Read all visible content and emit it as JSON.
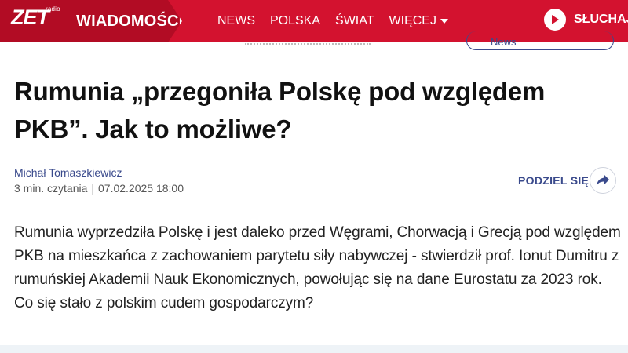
{
  "header": {
    "logo_text": "ZET",
    "logo_sub": "radio",
    "section": "WIADOMOŚCI",
    "nav": [
      "NEWS",
      "POLSKA",
      "ŚWIAT",
      "WIĘCEJ"
    ],
    "listen_label": "SŁUCHAJ R"
  },
  "peek": {
    "pill_text": "News"
  },
  "article": {
    "title": "Rumunia „przegoniła Polskę pod względem PKB”. Jak to możliwe?",
    "author": "Michał Tomaszkiewicz",
    "read_time": "3 min. czytania",
    "date": "07.02.2025 18:00",
    "share_label": "PODZIEL SIĘ",
    "lead": "Rumunia wyprzedziła Polskę i jest daleko przed Węgrami, Chorwacją i Grecją pod względem PKB na mieszkańca z zachowaniem parytetu siły nabywczej - stwierdził prof. Ionut Dumitru z rumuńskiej Akademii Nauk Ekonomicznych, powołując się na dane Eurostatu za 2023 rok. Co się stało z polskim cudem gospodarczym?"
  },
  "colors": {
    "brand_red": "#d3122f",
    "brand_dark": "#b20c24",
    "accent_blue": "#3a4a8c"
  },
  "icons": {
    "play": "play-icon",
    "share": "share-arrow-icon",
    "caret": "chevron-down-icon"
  }
}
